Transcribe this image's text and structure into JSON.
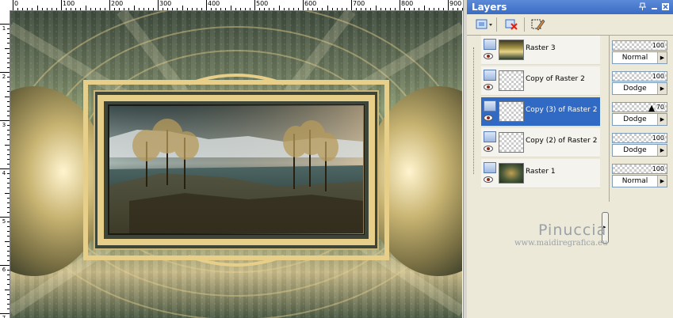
{
  "ruler": {
    "top_labels": [
      "0",
      "100",
      "200",
      "300",
      "400",
      "500",
      "600",
      "700",
      "800",
      "900"
    ],
    "left_labels": [
      "1",
      "2",
      "3",
      "4",
      "5",
      "6",
      "7"
    ]
  },
  "layers_panel": {
    "title": "Layers",
    "title_buttons": [
      "pin-icon",
      "minimize-icon",
      "close-icon"
    ],
    "toolbar_icons": [
      "new-raster-layer-icon",
      "delete-layer-icon",
      "edit-selection-icon"
    ],
    "layers": [
      {
        "name": "Raster 3",
        "thumbnail": "image",
        "selected": false,
        "opacity": "100",
        "blend_mode": "Normal"
      },
      {
        "name": "Copy of Raster 2",
        "thumbnail": "transparent",
        "selected": false,
        "opacity": "100",
        "blend_mode": "Dodge"
      },
      {
        "name": "Copy (3) of Raster 2",
        "thumbnail": "transparent",
        "selected": true,
        "opacity": "70",
        "blend_mode": "Dodge"
      },
      {
        "name": "Copy (2) of Raster 2",
        "thumbnail": "transparent",
        "selected": false,
        "opacity": "100",
        "blend_mode": "Dodge"
      },
      {
        "name": "Raster 1",
        "thumbnail": "image",
        "selected": false,
        "opacity": "100",
        "blend_mode": "Normal"
      }
    ],
    "collapse_arrow": "▸"
  },
  "watermark": {
    "name": "Pinuccia",
    "url": "www.maidiregrafica.eu"
  },
  "colors": {
    "title_bar": "#3a6cc4",
    "selection": "#316ac5",
    "panel_bg": "#ece9d8",
    "frame_gold": "#e7cf8a"
  }
}
